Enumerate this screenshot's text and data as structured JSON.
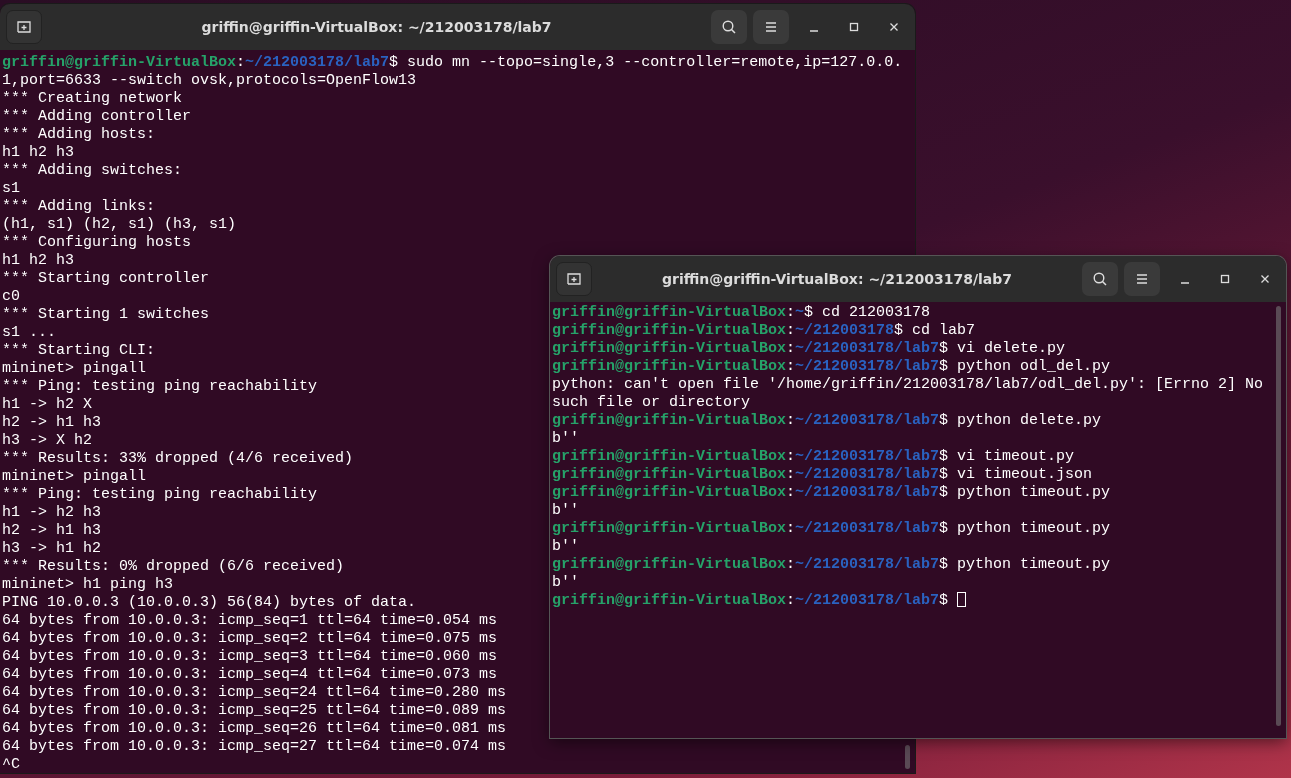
{
  "windows": [
    {
      "title": "griffin@griffin-VirtualBox: ~/212003178/lab7",
      "lines": [
        {
          "kind": "prompt",
          "user": "griffin@griffin-VirtualBox",
          "sep": ":",
          "path": "~/212003178/lab7",
          "command": "$ sudo mn --topo=single,3 --controller=remote,ip=127.0.0."
        },
        {
          "kind": "output",
          "text": "1,port=6633 --switch ovsk,protocols=OpenFlow13"
        },
        {
          "kind": "output",
          "text": "*** Creating network"
        },
        {
          "kind": "output",
          "text": "*** Adding controller"
        },
        {
          "kind": "output",
          "text": "*** Adding hosts:"
        },
        {
          "kind": "output",
          "text": "h1 h2 h3"
        },
        {
          "kind": "output",
          "text": "*** Adding switches:"
        },
        {
          "kind": "output",
          "text": "s1"
        },
        {
          "kind": "output",
          "text": "*** Adding links:"
        },
        {
          "kind": "output",
          "text": "(h1, s1) (h2, s1) (h3, s1)"
        },
        {
          "kind": "output",
          "text": "*** Configuring hosts"
        },
        {
          "kind": "output",
          "text": "h1 h2 h3"
        },
        {
          "kind": "output",
          "text": "*** Starting controller"
        },
        {
          "kind": "output",
          "text": "c0"
        },
        {
          "kind": "output",
          "text": "*** Starting 1 switches"
        },
        {
          "kind": "output",
          "text": "s1 ..."
        },
        {
          "kind": "output",
          "text": "*** Starting CLI:"
        },
        {
          "kind": "output",
          "text": "mininet> pingall"
        },
        {
          "kind": "output",
          "text": "*** Ping: testing ping reachability"
        },
        {
          "kind": "output",
          "text": "h1 -> h2 X"
        },
        {
          "kind": "output",
          "text": "h2 -> h1 h3"
        },
        {
          "kind": "output",
          "text": "h3 -> X h2"
        },
        {
          "kind": "output",
          "text": "*** Results: 33% dropped (4/6 received)"
        },
        {
          "kind": "output",
          "text": "mininet> pingall"
        },
        {
          "kind": "output",
          "text": "*** Ping: testing ping reachability"
        },
        {
          "kind": "output",
          "text": "h1 -> h2 h3"
        },
        {
          "kind": "output",
          "text": "h2 -> h1 h3"
        },
        {
          "kind": "output",
          "text": "h3 -> h1 h2"
        },
        {
          "kind": "output",
          "text": "*** Results: 0% dropped (6/6 received)"
        },
        {
          "kind": "output",
          "text": "mininet> h1 ping h3"
        },
        {
          "kind": "output",
          "text": "PING 10.0.0.3 (10.0.0.3) 56(84) bytes of data."
        },
        {
          "kind": "output",
          "text": "64 bytes from 10.0.0.3: icmp_seq=1 ttl=64 time=0.054 ms"
        },
        {
          "kind": "output",
          "text": "64 bytes from 10.0.0.3: icmp_seq=2 ttl=64 time=0.075 ms"
        },
        {
          "kind": "output",
          "text": "64 bytes from 10.0.0.3: icmp_seq=3 ttl=64 time=0.060 ms"
        },
        {
          "kind": "output",
          "text": "64 bytes from 10.0.0.3: icmp_seq=4 ttl=64 time=0.073 ms"
        },
        {
          "kind": "output",
          "text": "64 bytes from 10.0.0.3: icmp_seq=24 ttl=64 time=0.280 ms"
        },
        {
          "kind": "output",
          "text": "64 bytes from 10.0.0.3: icmp_seq=25 ttl=64 time=0.089 ms"
        },
        {
          "kind": "output",
          "text": "64 bytes from 10.0.0.3: icmp_seq=26 ttl=64 time=0.081 ms"
        },
        {
          "kind": "output",
          "text": "64 bytes from 10.0.0.3: icmp_seq=27 ttl=64 time=0.074 ms"
        },
        {
          "kind": "output",
          "text": "^C"
        }
      ]
    },
    {
      "title": "griffin@griffin-VirtualBox: ~/212003178/lab7",
      "lines": [
        {
          "kind": "prompt",
          "user": "griffin@griffin-VirtualBox",
          "sep": ":",
          "path": "~",
          "command": "$ cd 212003178"
        },
        {
          "kind": "prompt",
          "user": "griffin@griffin-VirtualBox",
          "sep": ":",
          "path": "~/212003178",
          "command": "$ cd lab7"
        },
        {
          "kind": "prompt",
          "user": "griffin@griffin-VirtualBox",
          "sep": ":",
          "path": "~/212003178/lab7",
          "command": "$ vi delete.py"
        },
        {
          "kind": "prompt",
          "user": "griffin@griffin-VirtualBox",
          "sep": ":",
          "path": "~/212003178/lab7",
          "command": "$ python odl_del.py"
        },
        {
          "kind": "output",
          "text": "python: can't open file '/home/griffin/212003178/lab7/odl_del.py': [Errno 2] No"
        },
        {
          "kind": "output",
          "text": "such file or directory"
        },
        {
          "kind": "prompt",
          "user": "griffin@griffin-VirtualBox",
          "sep": ":",
          "path": "~/212003178/lab7",
          "command": "$ python delete.py"
        },
        {
          "kind": "output",
          "text": "b''"
        },
        {
          "kind": "prompt",
          "user": "griffin@griffin-VirtualBox",
          "sep": ":",
          "path": "~/212003178/lab7",
          "command": "$ vi timeout.py"
        },
        {
          "kind": "prompt",
          "user": "griffin@griffin-VirtualBox",
          "sep": ":",
          "path": "~/212003178/lab7",
          "command": "$ vi timeout.json"
        },
        {
          "kind": "prompt",
          "user": "griffin@griffin-VirtualBox",
          "sep": ":",
          "path": "~/212003178/lab7",
          "command": "$ python timeout.py"
        },
        {
          "kind": "output",
          "text": "b''"
        },
        {
          "kind": "prompt",
          "user": "griffin@griffin-VirtualBox",
          "sep": ":",
          "path": "~/212003178/lab7",
          "command": "$ python timeout.py"
        },
        {
          "kind": "output",
          "text": "b''"
        },
        {
          "kind": "prompt",
          "user": "griffin@griffin-VirtualBox",
          "sep": ":",
          "path": "~/212003178/lab7",
          "command": "$ python timeout.py"
        },
        {
          "kind": "output",
          "text": "b''"
        },
        {
          "kind": "prompt",
          "user": "griffin@griffin-VirtualBox",
          "sep": ":",
          "path": "~/212003178/lab7",
          "command": "$",
          "cursor": true
        }
      ]
    }
  ]
}
